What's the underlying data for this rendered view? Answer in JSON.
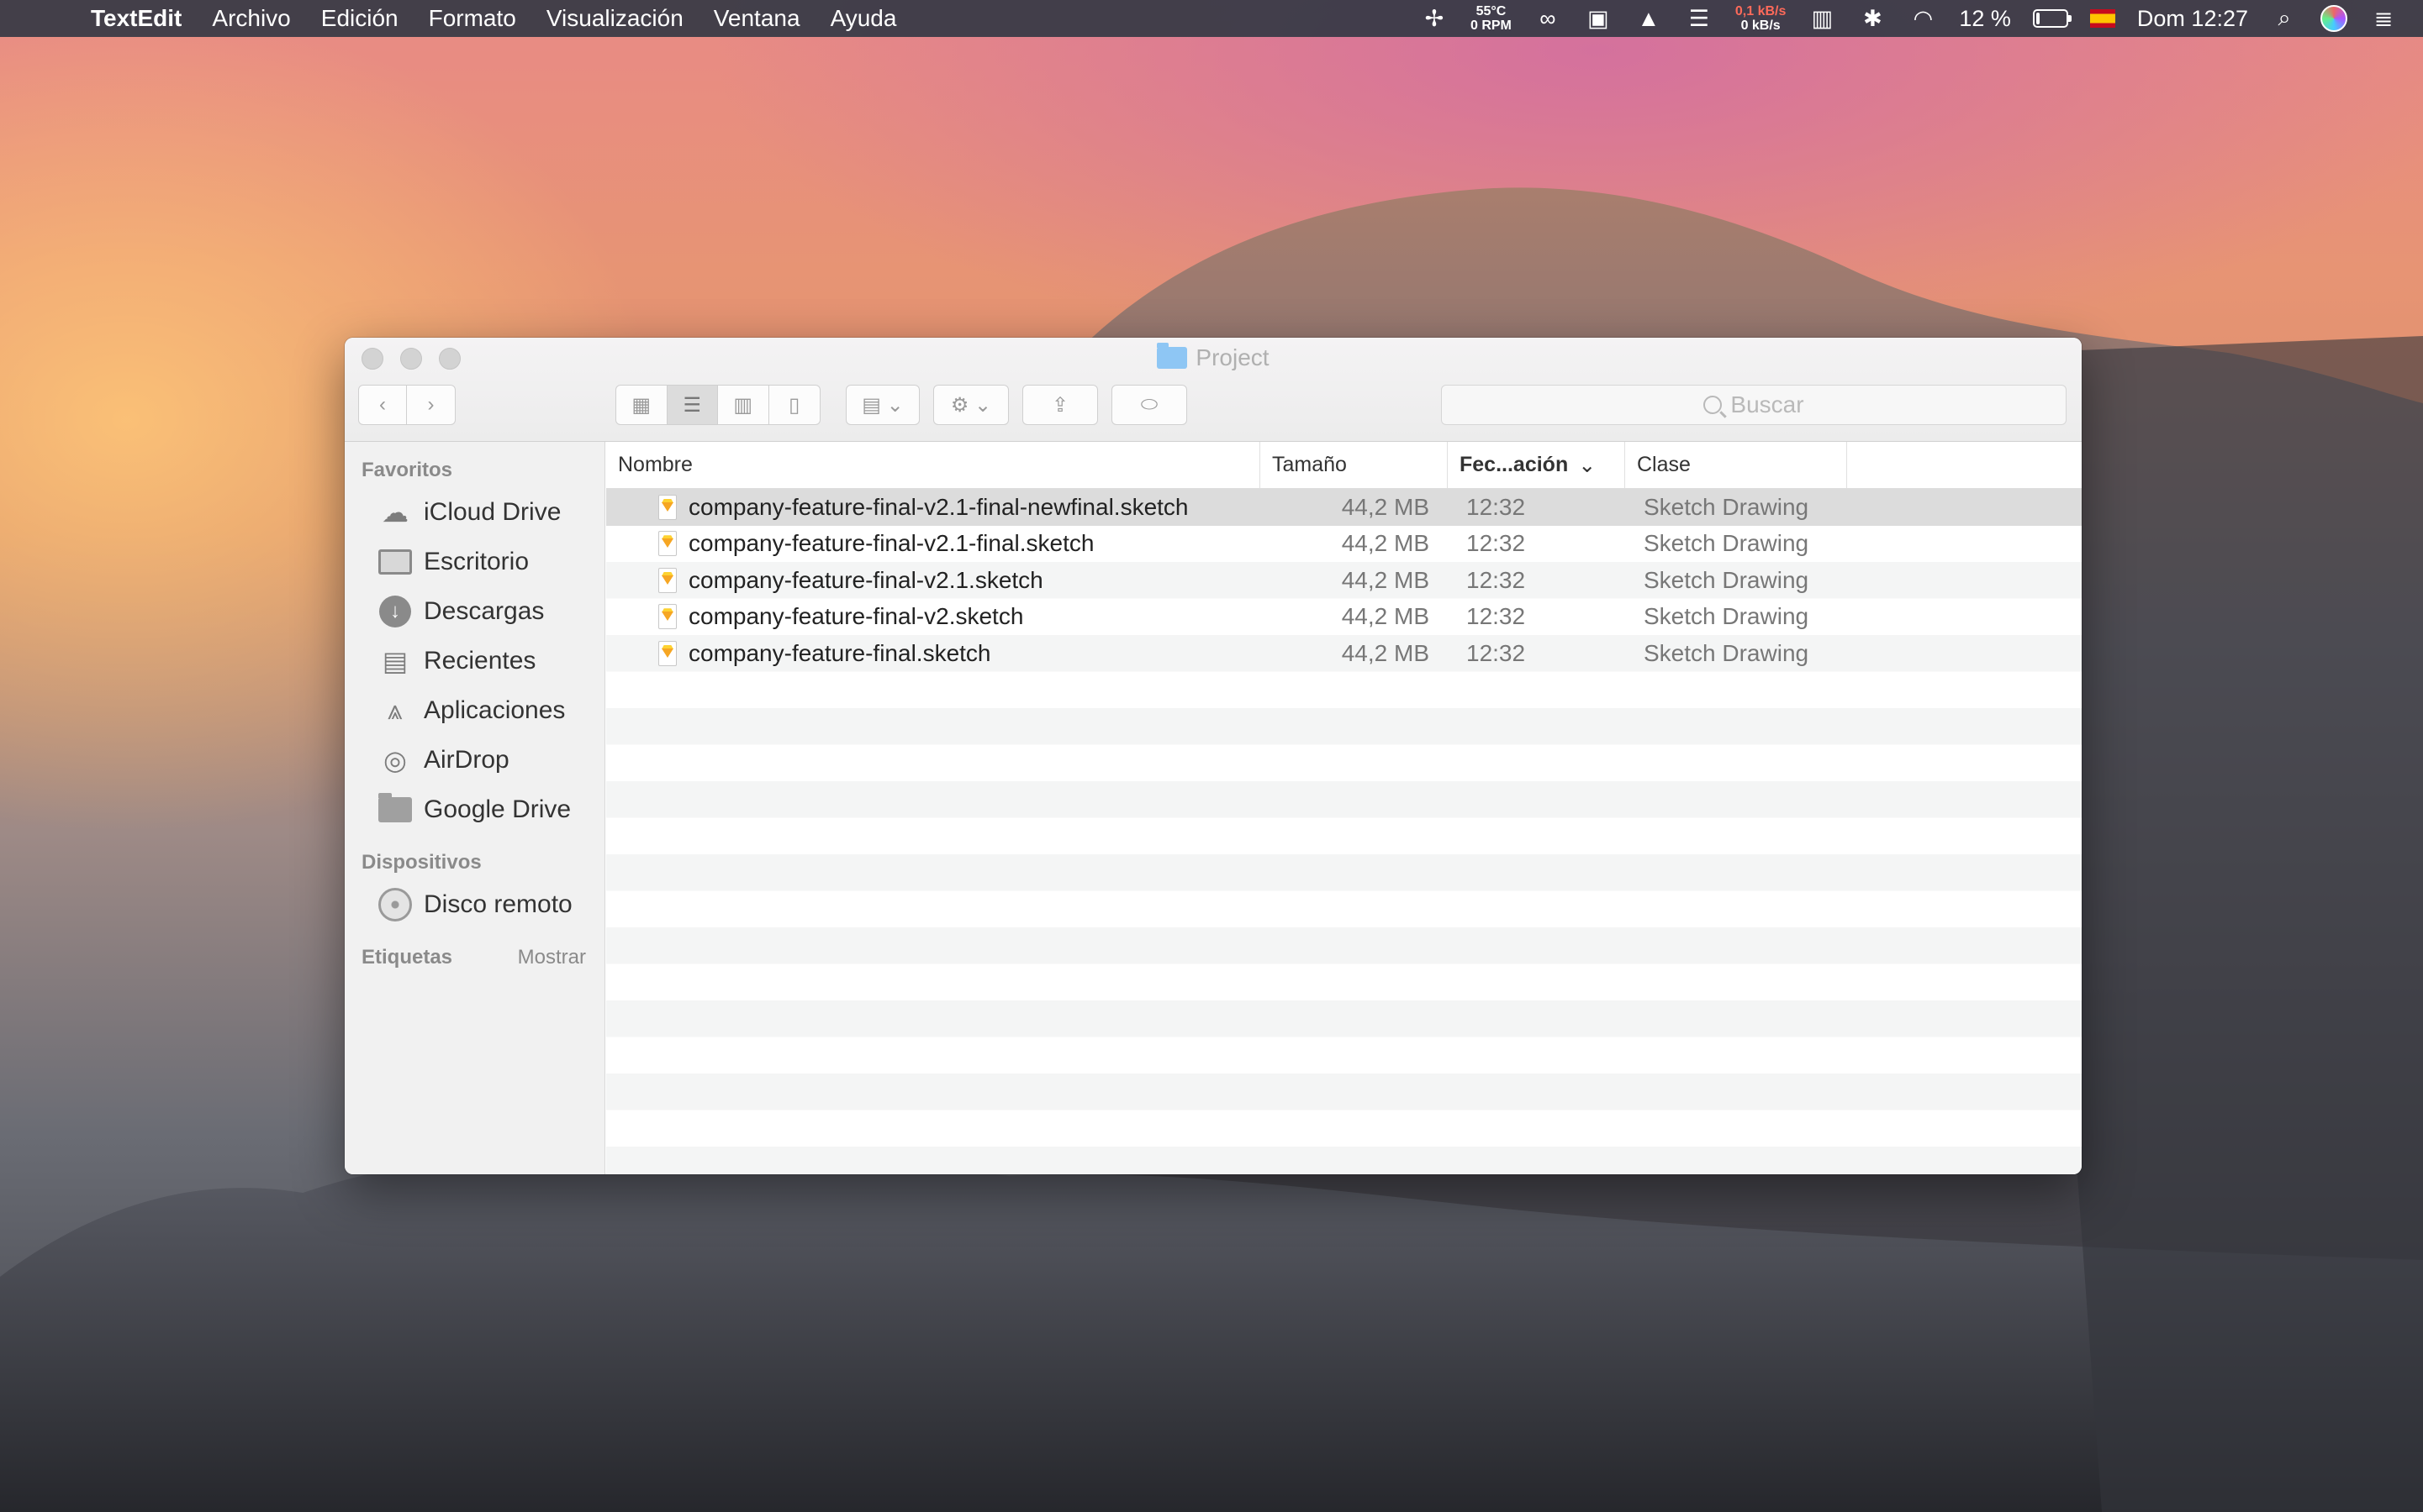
{
  "menubar": {
    "app_name": "TextEdit",
    "menus": [
      "Archivo",
      "Edición",
      "Formato",
      "Visualización",
      "Ventana",
      "Ayuda"
    ],
    "temp": "55°C",
    "fan": "0 RPM",
    "net_up": "0,1 kB/s",
    "net_down": "0 kB/s",
    "battery": "12 %",
    "battery_level": 0.12,
    "clock": "Dom 12:27"
  },
  "window": {
    "title": "Project",
    "search_placeholder": "Buscar"
  },
  "sidebar": {
    "favorites_header": "Favoritos",
    "favorites": [
      {
        "label": "iCloud Drive",
        "icon": "cloud-icon"
      },
      {
        "label": "Escritorio",
        "icon": "desktop-icon"
      },
      {
        "label": "Descargas",
        "icon": "downloads-icon"
      },
      {
        "label": "Recientes",
        "icon": "recents-icon"
      },
      {
        "label": "Aplicaciones",
        "icon": "applications-icon"
      },
      {
        "label": "AirDrop",
        "icon": "airdrop-icon"
      },
      {
        "label": "Google Drive",
        "icon": "folder-icon"
      }
    ],
    "devices_header": "Dispositivos",
    "devices": [
      {
        "label": "Disco remoto",
        "icon": "disc-icon"
      }
    ],
    "tags_header": "Etiquetas",
    "tags_action": "Mostrar"
  },
  "list": {
    "columns": {
      "name": "Nombre",
      "size": "Tamaño",
      "date": "Fec...ación",
      "kind": "Clase"
    },
    "files": [
      {
        "name": "company-feature-final-v2.1-final-newfinal.sketch",
        "size": "44,2 MB",
        "date": "12:32",
        "kind": "Sketch Drawing"
      },
      {
        "name": "company-feature-final-v2.1-final.sketch",
        "size": "44,2 MB",
        "date": "12:32",
        "kind": "Sketch Drawing"
      },
      {
        "name": "company-feature-final-v2.1.sketch",
        "size": "44,2 MB",
        "date": "12:32",
        "kind": "Sketch Drawing"
      },
      {
        "name": "company-feature-final-v2.sketch",
        "size": "44,2 MB",
        "date": "12:32",
        "kind": "Sketch Drawing"
      },
      {
        "name": "company-feature-final.sketch",
        "size": "44,2 MB",
        "date": "12:32",
        "kind": "Sketch Drawing"
      }
    ]
  }
}
